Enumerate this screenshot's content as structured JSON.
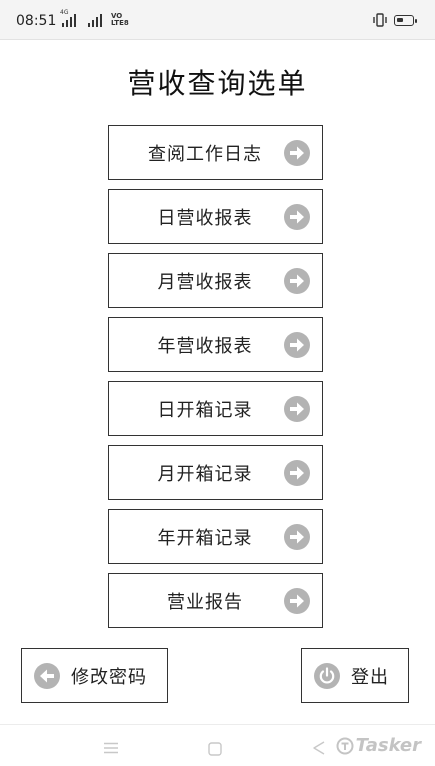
{
  "status": {
    "time": "08:51",
    "network": "4G",
    "volte_top": "VO",
    "volte_bottom": "LTE8"
  },
  "page": {
    "title": "营收查询选单"
  },
  "menu": [
    {
      "id": "work-log",
      "label": "查阅工作日志"
    },
    {
      "id": "daily-revenue",
      "label": "日营收报表"
    },
    {
      "id": "monthly-revenue",
      "label": "月营收报表"
    },
    {
      "id": "yearly-revenue",
      "label": "年营收报表"
    },
    {
      "id": "daily-box",
      "label": "日开箱记录"
    },
    {
      "id": "monthly-box",
      "label": "月开箱记录"
    },
    {
      "id": "yearly-box",
      "label": "年开箱记录"
    },
    {
      "id": "business-report",
      "label": "营业报告"
    }
  ],
  "actions": {
    "change_password": "修改密码",
    "logout": "登出"
  },
  "icons": {
    "menu_arrow": "arrow-right-circle-icon",
    "back": "arrow-left-circle-icon",
    "power": "power-icon"
  },
  "watermark": "Tasker",
  "colors": {
    "icon": "#b3b3b3",
    "border": "#333333",
    "status_bg": "#f4f4f4"
  }
}
